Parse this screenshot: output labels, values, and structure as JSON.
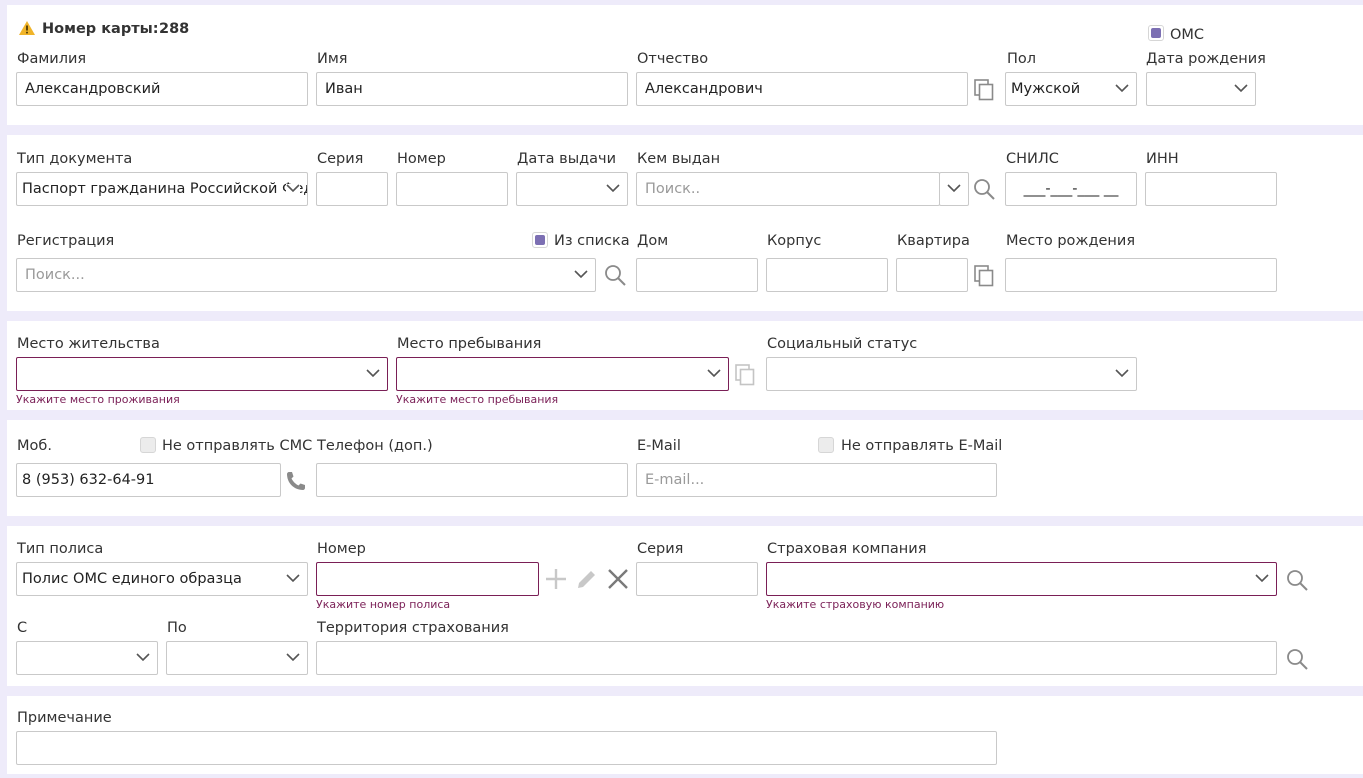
{
  "card": {
    "label": "Номер карты:",
    "number": "288",
    "oms_label": "ОМС"
  },
  "person": {
    "surname_label": "Фамилия",
    "surname": "Александровский",
    "name_label": "Имя",
    "name": "Иван",
    "patronymic_label": "Отчество",
    "patronymic": "Александрович",
    "sex_label": "Пол",
    "sex": "Мужской",
    "birth_label": "Дата рождения"
  },
  "document": {
    "type_label": "Тип документа",
    "type": "Паспорт гражданина Российской Федерации",
    "series_label": "Серия",
    "number_label": "Номер",
    "issue_date_label": "Дата выдачи",
    "issuer_label": "Кем выдан",
    "issuer_placeholder": "Поиск..",
    "snils_label": "СНИЛС",
    "snils_mask": "___-___-___ __",
    "inn_label": "ИНН"
  },
  "registration": {
    "label": "Регистрация",
    "placeholder": "Поиск...",
    "from_list_label": "Из списка",
    "house_label": "Дом",
    "building_label": "Корпус",
    "flat_label": "Квартира",
    "birthplace_label": "Место рождения"
  },
  "residence": {
    "live_label": "Место жительства",
    "live_error": "Укажите место проживания",
    "stay_label": "Место пребывания",
    "stay_error": "Укажите место пребывания",
    "social_label": "Социальный статус"
  },
  "contacts": {
    "mobile_label": "Моб.",
    "mobile": "8 (953) 632-64-91",
    "no_sms_label": "Не отправлять СМС",
    "phone_extra_label": "Телефон (доп.)",
    "email_label": "E-Mail",
    "email_placeholder": "E-mail...",
    "no_email_label": "Не отправлять E-Mail"
  },
  "policy": {
    "type_label": "Тип полиса",
    "type": "Полис ОМС единого образца",
    "number_label": "Номер",
    "number_error": "Укажите номер полиса",
    "series_label": "Серия",
    "insurer_label": "Страховая компания",
    "insurer_error": "Укажите страховую компанию",
    "from_label": "С",
    "to_label": "По",
    "territory_label": "Территория страхования"
  },
  "note": {
    "label": "Примечание"
  },
  "colors": {
    "accent": "#7c6fb3",
    "error": "#7a1f56",
    "background": "#eeebfa",
    "warning": "#f0b429"
  }
}
